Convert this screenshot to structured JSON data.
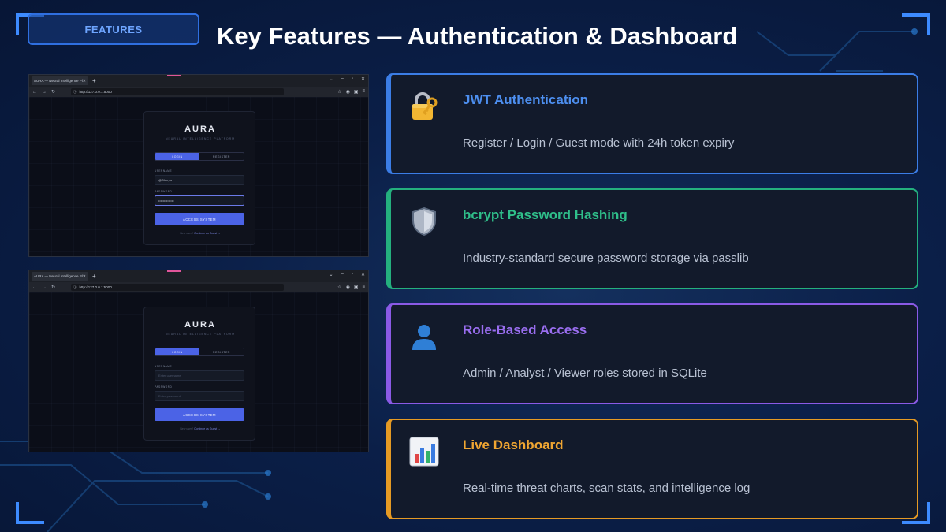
{
  "slide": {
    "tag": "FEATURES",
    "title": "Key Features — Authentication & Dashboard"
  },
  "screenshots": [
    {
      "tab_title": "AURA — Neural Intelligence Platfor",
      "url": "http://127.0.0.1:5000",
      "app_logo": "AURA",
      "app_subtitle": "NEURAL INTELLIGENCE PLATFORM",
      "login_tab": "LOGIN",
      "register_tab": "REGISTER",
      "username_label": "USERNAME",
      "username_value": "@Shreya",
      "password_label": "PASSWORD",
      "password_value": "••••••••••••••",
      "submit_label": "ACCESS SYSTEM",
      "guest_prefix": "New user?",
      "guest_link": "Continue as Guest →"
    },
    {
      "tab_title": "AURA — Neural Intelligence Platfor",
      "url": "http://127.0.0.1:5000",
      "app_logo": "AURA",
      "app_subtitle": "NEURAL INTELLIGENCE PLATFORM",
      "login_tab": "LOGIN",
      "register_tab": "REGISTER",
      "username_label": "USERNAME",
      "username_placeholder": "Enter username",
      "password_label": "PASSWORD",
      "password_placeholder": "Enter password",
      "submit_label": "ACCESS SYSTEM",
      "guest_prefix": "New user?",
      "guest_link": "Continue as Guest →"
    }
  ],
  "features": [
    {
      "icon": "padlock-key-icon",
      "title": "JWT Authentication",
      "description": "Register / Login / Guest mode with 24h token expiry",
      "color": "#3b7de6",
      "title_color": "#4d8ff0"
    },
    {
      "icon": "shield-icon",
      "title": "bcrypt Password Hashing",
      "description": "Industry-standard secure password storage via passlib",
      "color": "#24b07e",
      "title_color": "#2fbf8a"
    },
    {
      "icon": "user-silhouette-icon",
      "title": "Role-Based Access",
      "description": "Admin / Analyst / Viewer roles stored in SQLite",
      "color": "#8a5ae6",
      "title_color": "#9a6ef0"
    },
    {
      "icon": "bar-chart-icon",
      "title": "Live Dashboard",
      "description": "Real-time threat charts, scan stats, and intelligence log",
      "color": "#e59a24",
      "title_color": "#f0a632"
    }
  ]
}
